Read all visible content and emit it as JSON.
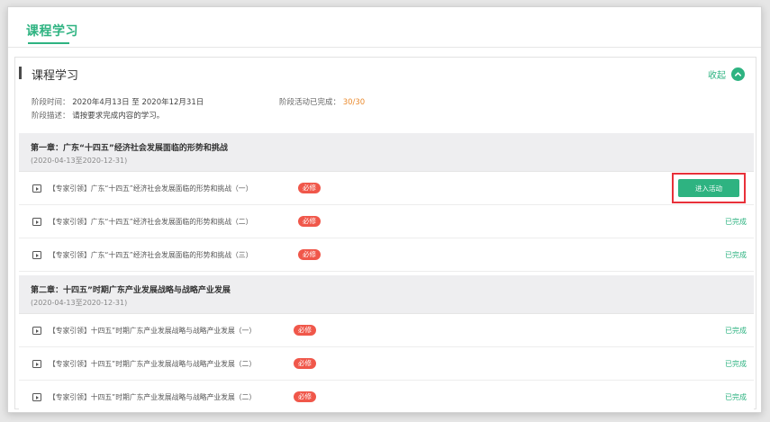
{
  "top_tab": {
    "label": "课程学习"
  },
  "section": {
    "title": "课程学习",
    "collapse_label": "收起",
    "time_label": "阶段时间：",
    "time_value": "2020年4月13日 至 2020年12月31日",
    "done_label": "阶段活动已完成：",
    "done_value": "30/30",
    "desc_label": "阶段描述：",
    "desc_value": "请按要求完成内容的学习。"
  },
  "chapters": [
    {
      "title": "第一章：广东“十四五”经济社会发展面临的形势和挑战",
      "range": "(2020-04-13至2020-12-31)",
      "items": [
        {
          "text": "【专家引领】广东“十四五”经济社会发展面临的形势和挑战（一）",
          "badge": "必修",
          "action": "进入活动"
        },
        {
          "text": "【专家引领】广东“十四五”经济社会发展面临的形势和挑战（二）",
          "badge": "必修",
          "status": "已完成"
        },
        {
          "text": "【专家引领】广东“十四五”经济社会发展面临的形势和挑战（三）",
          "badge": "必修",
          "status": "已完成"
        }
      ]
    },
    {
      "title": "第二章：十四五”时期广东产业发展战略与战略产业发展",
      "range": "(2020-04-13至2020-12-31)",
      "items": [
        {
          "text": "【专家引领】十四五”时期广东产业发展战略与战略产业发展（一）",
          "badge": "必修",
          "status": "已完成"
        },
        {
          "text": "【专家引领】十四五”时期广东产业发展战略与战略产业发展（二）",
          "badge": "必修",
          "status": "已完成"
        },
        {
          "text": "【专家引领】十四五”时期广东产业发展战略与战略产业发展（二）",
          "badge": "必修",
          "status": "已完成"
        }
      ]
    }
  ],
  "colors": {
    "accent": "#2eb381",
    "badge": "#f0574a",
    "progress": "#ea8a2d",
    "highlight": "#e8313a"
  }
}
